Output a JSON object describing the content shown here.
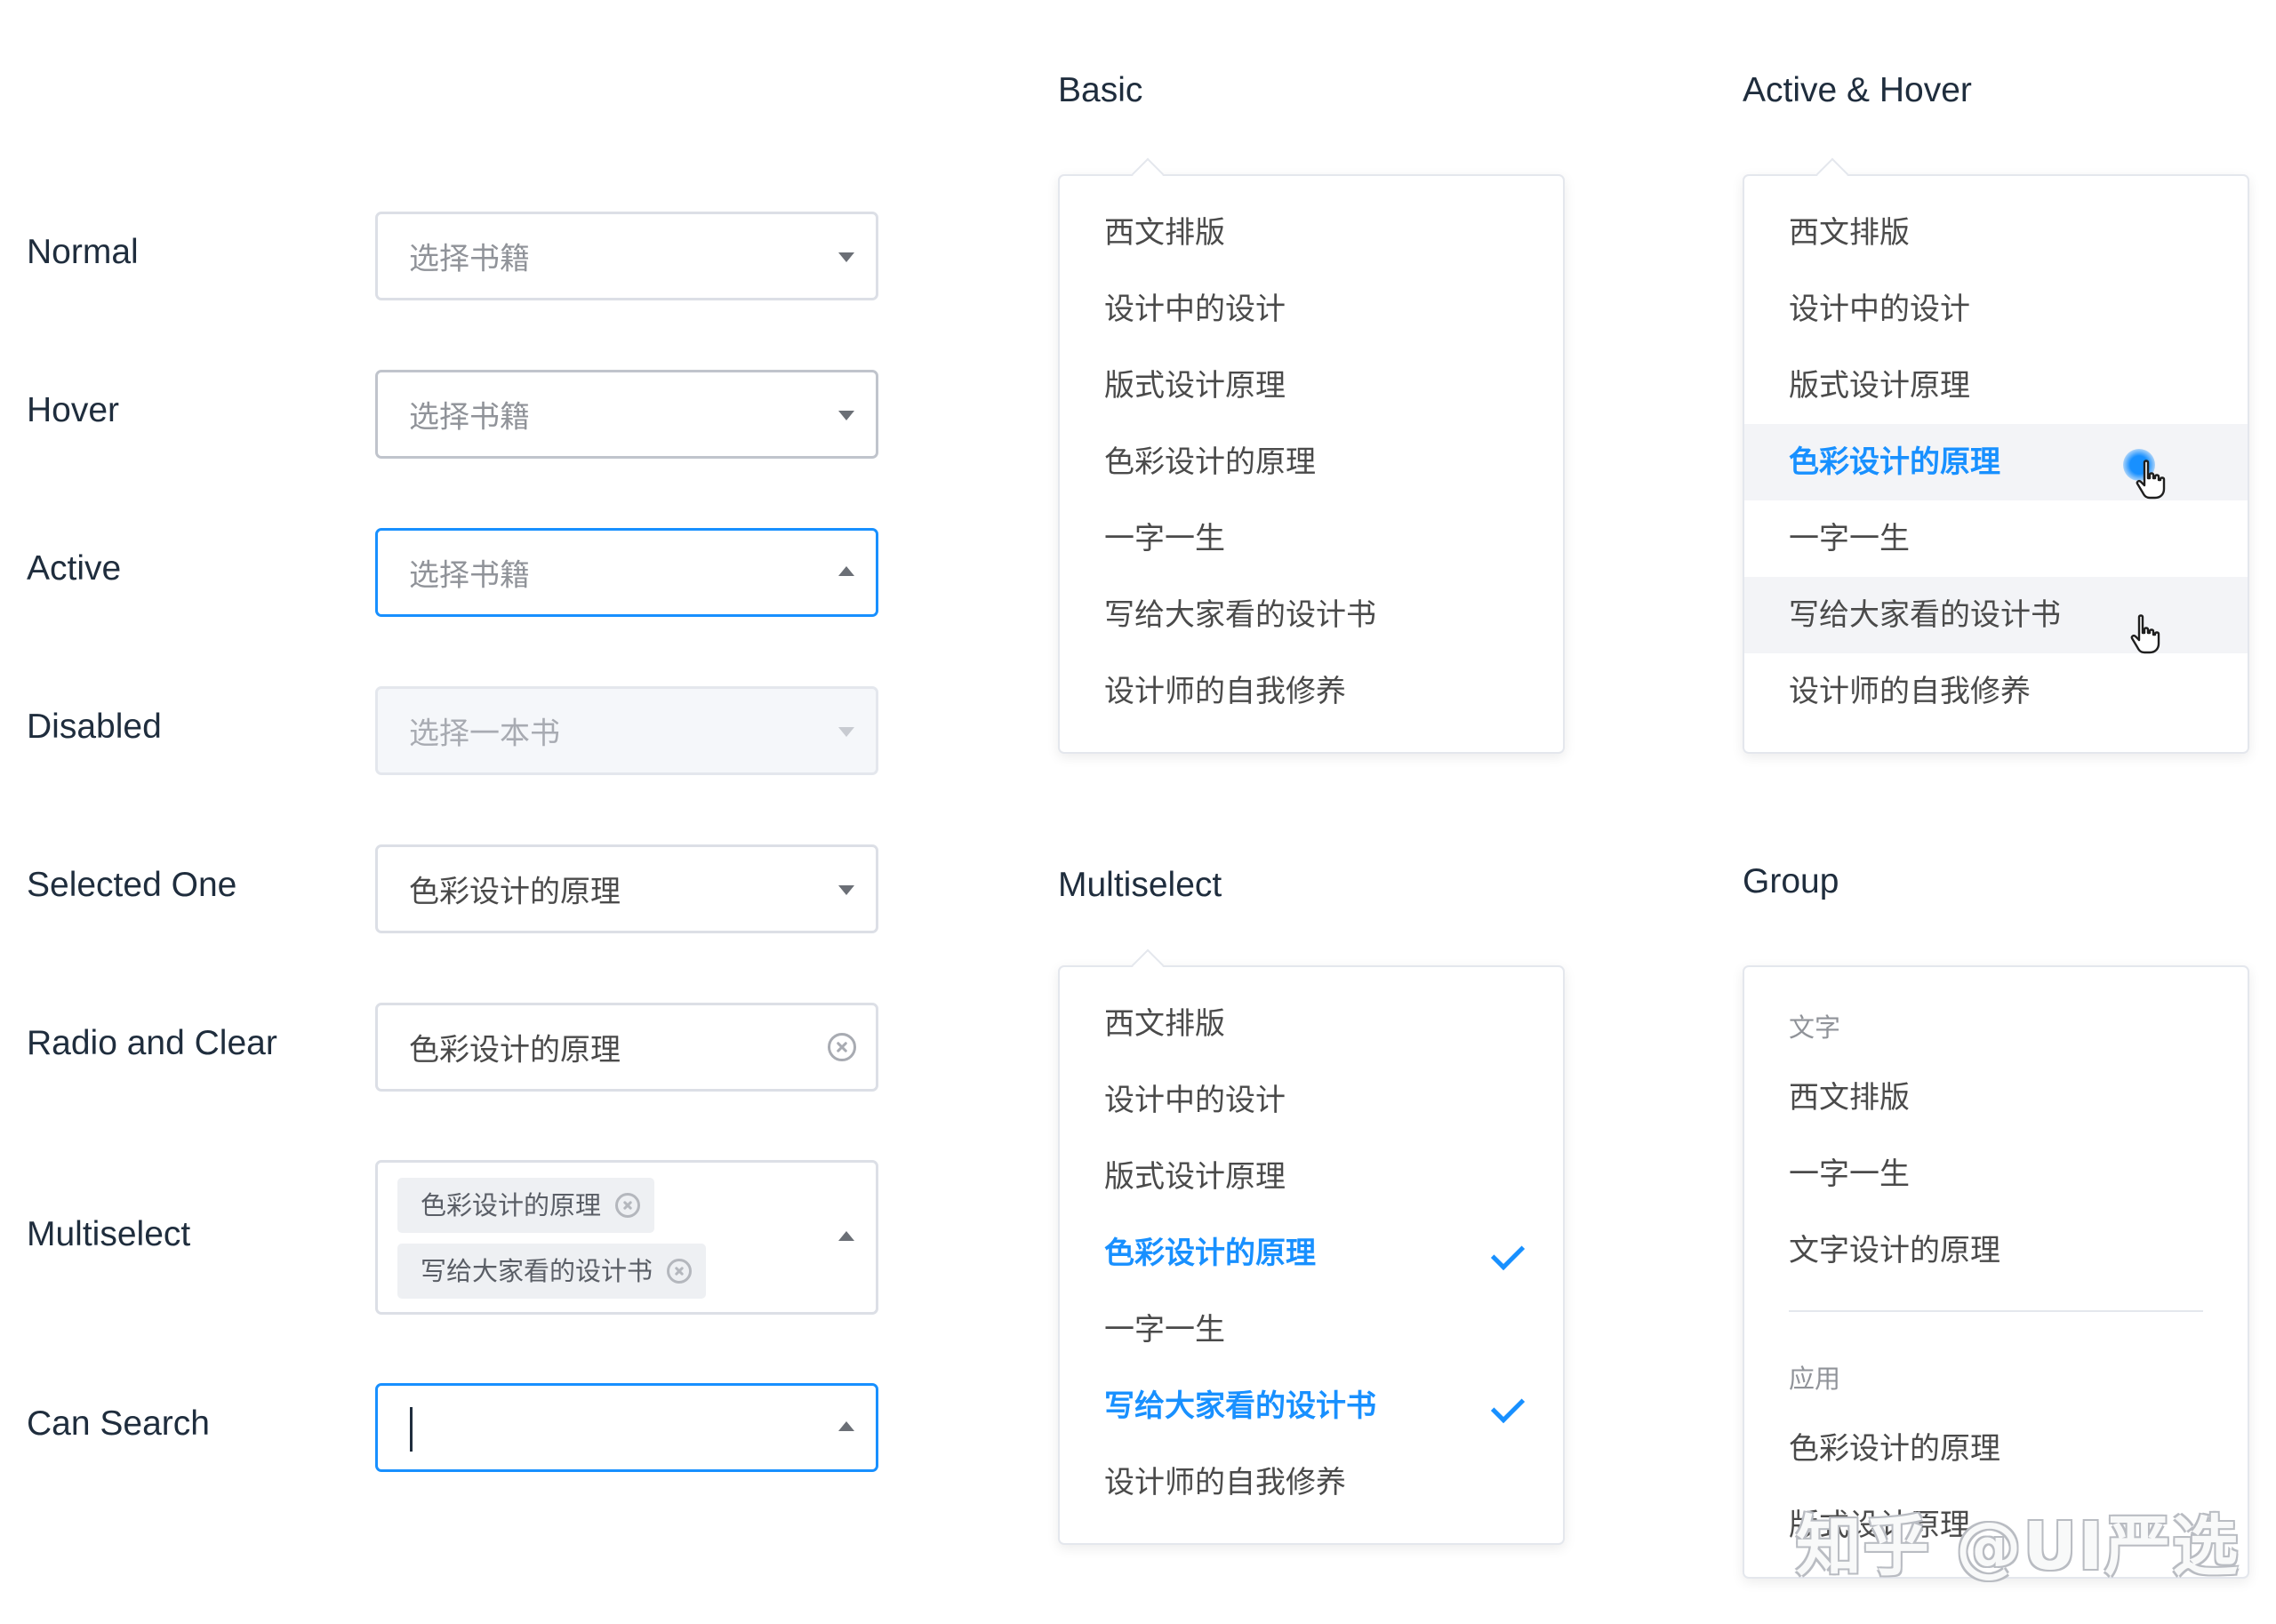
{
  "states": {
    "normal": {
      "label": "Normal",
      "placeholder": "选择书籍"
    },
    "hover": {
      "label": "Hover",
      "placeholder": "选择书籍"
    },
    "active": {
      "label": "Active",
      "placeholder": "选择书籍"
    },
    "disabled": {
      "label": "Disabled",
      "placeholder": "选择一本书"
    },
    "selected_one": {
      "label": "Selected One",
      "value": "色彩设计的原理"
    },
    "radio_clear": {
      "label": "Radio and Clear",
      "value": "色彩设计的原理"
    },
    "multiselect": {
      "label": "Multiselect",
      "tags": [
        "色彩设计的原理",
        "写给大家看的设计书"
      ]
    },
    "can_search": {
      "label": "Can Search",
      "value": ""
    }
  },
  "panels": {
    "basic": {
      "title": "Basic",
      "options": [
        "西文排版",
        "设计中的设计",
        "版式设计原理",
        "色彩设计的原理",
        "一字一生",
        "写给大家看的设计书",
        "设计师的自我修养"
      ]
    },
    "active_hover": {
      "title": "Active & Hover",
      "options": [
        "西文排版",
        "设计中的设计",
        "版式设计原理",
        "色彩设计的原理",
        "一字一生",
        "写给大家看的设计书",
        "设计师的自我修养"
      ],
      "active_option": "色彩设计的原理",
      "hover_option": "写给大家看的设计书"
    },
    "multiselect": {
      "title": "Multiselect",
      "options": [
        "西文排版",
        "设计中的设计",
        "版式设计原理",
        "色彩设计的原理",
        "一字一生",
        "写给大家看的设计书",
        "设计师的自我修养"
      ],
      "selected": [
        "色彩设计的原理",
        "写给大家看的设计书"
      ]
    },
    "group": {
      "title": "Group",
      "groups": [
        {
          "label": "文字",
          "options": [
            "西文排版",
            "一字一生",
            "文字设计的原理"
          ]
        },
        {
          "label": "应用",
          "options": [
            "色彩设计的原理",
            "版式设计原理"
          ]
        }
      ]
    }
  },
  "watermark": "知乎 @UI严选",
  "colors": {
    "accent": "#1890ff",
    "text": "#4a4a4a",
    "placeholder": "#909399",
    "border": "#dcdfe6"
  },
  "icons": [
    "caret-down-icon",
    "caret-up-icon",
    "clear-icon",
    "tag-close-icon",
    "check-icon",
    "hand-cursor-icon"
  ]
}
